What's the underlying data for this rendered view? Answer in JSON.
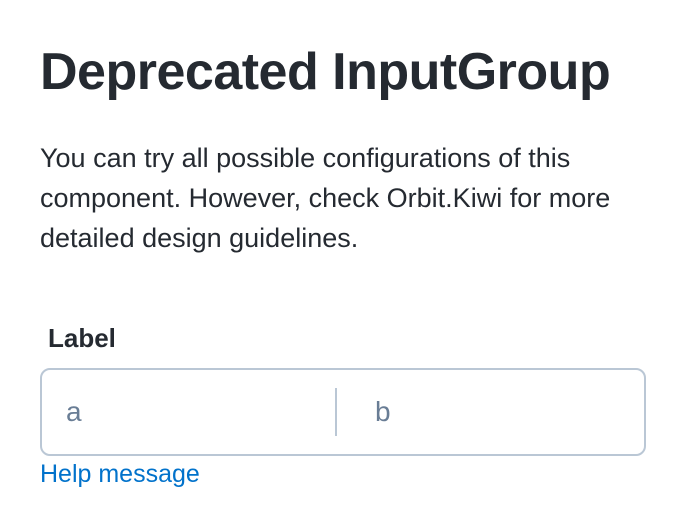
{
  "title": "Deprecated InputGroup",
  "description": "You can try all possible configurations of this component. However, check Orbit.Kiwi for more detailed design guidelines.",
  "input_group": {
    "label": "Label",
    "fields": [
      {
        "placeholder": "a",
        "value": ""
      },
      {
        "placeholder": "b",
        "value": ""
      }
    ],
    "help": "Help message"
  }
}
